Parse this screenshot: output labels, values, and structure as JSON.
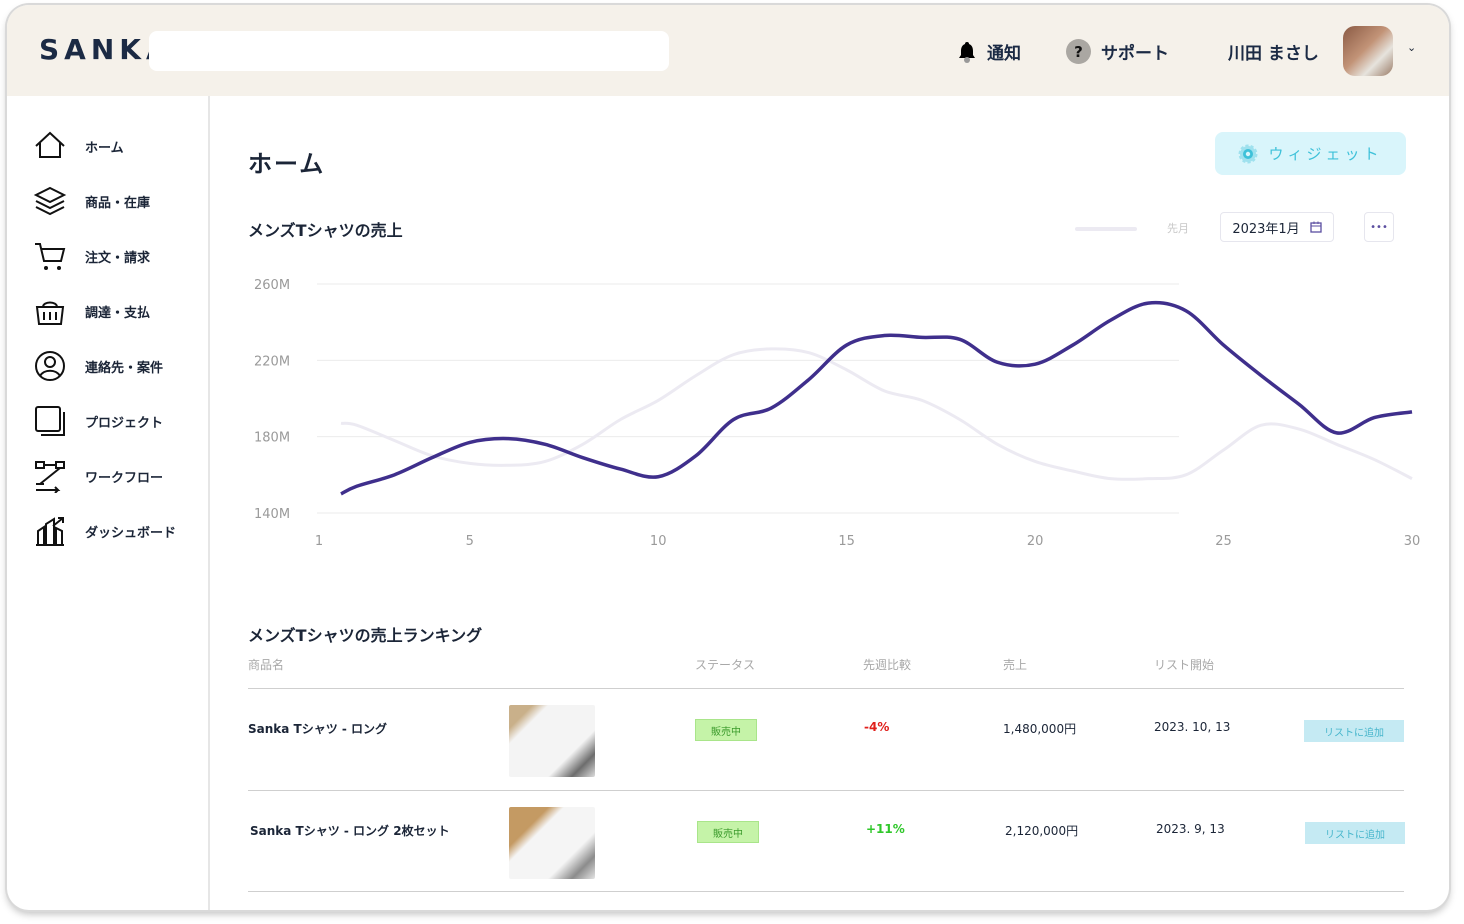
{
  "header": {
    "logo": "SANKA",
    "search_placeholder": "",
    "notify": "通知",
    "support": "サポート",
    "user": "川田 まさし"
  },
  "sidebar": {
    "items": [
      {
        "label": "ホーム",
        "icon": "home-icon"
      },
      {
        "label": "商品・在庫",
        "icon": "layers-icon"
      },
      {
        "label": "注文・請求",
        "icon": "cart-icon"
      },
      {
        "label": "調達・支払",
        "icon": "basket-icon"
      },
      {
        "label": "連絡先・案件",
        "icon": "user-circle-icon"
      },
      {
        "label": "プロジェクト",
        "icon": "project-icon"
      },
      {
        "label": "ワークフロー",
        "icon": "workflow-icon"
      },
      {
        "label": "ダッシュボード",
        "icon": "dashboard-icon"
      }
    ]
  },
  "page": {
    "title": "ホーム",
    "widget_label": "ウィジェット"
  },
  "chart_section": {
    "title": "メンズTシャツの売上",
    "legend_prev": "先月",
    "date": "2023年1月",
    "more": "•••"
  },
  "chart_data": {
    "type": "line",
    "title": "メンズTシャツの売上",
    "xlabel": "",
    "ylabel": "",
    "xlim": [
      1,
      30
    ],
    "ylim": [
      140,
      260
    ],
    "x_ticks": [
      1,
      5,
      10,
      15,
      20,
      25,
      30
    ],
    "y_ticks": [
      "140M",
      "180M",
      "220M",
      "260M"
    ],
    "y_tick_values": [
      140,
      180,
      220,
      260
    ],
    "x": [
      1,
      2,
      3,
      4,
      5,
      6,
      7,
      8,
      9,
      10,
      11,
      12,
      13,
      14,
      15,
      16,
      17,
      18,
      19,
      20,
      21,
      22,
      23,
      24,
      25,
      26,
      27,
      28,
      29,
      30
    ],
    "series": [
      {
        "name": "2023年1月",
        "color": "#3f2f8c",
        "values": [
          150,
          154,
          160,
          169,
          177,
          179,
          176,
          169,
          163,
          159,
          170,
          189,
          195,
          210,
          228,
          233,
          232,
          231,
          219,
          218,
          228,
          241,
          250,
          246,
          228,
          212,
          197,
          182,
          190,
          193
        ]
      },
      {
        "name": "先月",
        "color": "#eceaf2",
        "values": [
          187,
          186,
          178,
          170,
          166,
          165,
          167,
          176,
          189,
          199,
          212,
          223,
          226,
          224,
          215,
          204,
          199,
          189,
          176,
          167,
          162,
          158,
          158,
          160,
          173,
          186,
          184,
          176,
          168,
          158
        ]
      }
    ]
  },
  "ranking": {
    "title": "メンズTシャツの売上ランキング",
    "columns": [
      "商品名",
      "ステータス",
      "先週比較",
      "売上",
      "リスト開始"
    ],
    "rows": [
      {
        "name": "Sanka Tシャツ - ロング",
        "status": "販売中",
        "change": "-4%",
        "sales": "1,480,000円",
        "date": "2023. 10, 13",
        "action": "リストに追加"
      },
      {
        "name": "Sanka Tシャツ - ロング 2枚セット",
        "status": "販売中",
        "change": "+11%",
        "sales": "2,120,000円",
        "date": "2023. 9, 13",
        "action": "リストに追加"
      }
    ]
  },
  "colors": {
    "accent": "#3f2f8c",
    "negative": "#e0201c",
    "positive": "#2fc72a"
  }
}
